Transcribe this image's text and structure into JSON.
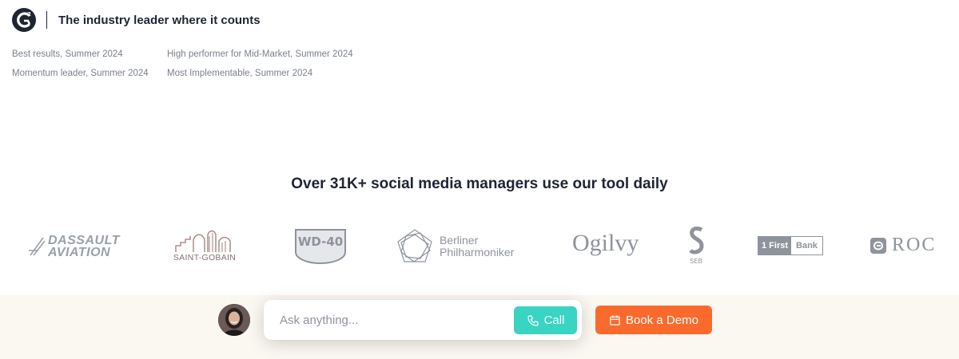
{
  "g2": {
    "logo_icon": "g2-logo-icon",
    "title": "The industry leader where it counts",
    "awards": [
      "Best results, Summer 2024",
      "High performer for Mid-Market, Summer 2024",
      "Momentum leader, Summer 2024",
      "Most Implementable, Summer 2024"
    ]
  },
  "social_proof": {
    "title": "Over 31K+ social media managers use our tool daily",
    "logos": {
      "dassault_line1": "DASSAULT",
      "dassault_line2": "AVIATION",
      "saint_gobain": "SAINT-GOBAIN",
      "wd40": "WD-40",
      "berliner_line1": "Berliner",
      "berliner_line2": "Philharmoniker",
      "ogilvy": "Ogilvy",
      "seb": "SEB",
      "firstbank_num": "1 First",
      "firstbank_word": "Bank",
      "roc": "ROC"
    }
  },
  "chat_bar": {
    "placeholder": "Ask anything...",
    "call_label": "Call",
    "demo_label": "Book a Demo"
  },
  "colors": {
    "call": "#39d4c2",
    "demo": "#fb6a2d",
    "bar_bg": "#fbf7f1"
  }
}
